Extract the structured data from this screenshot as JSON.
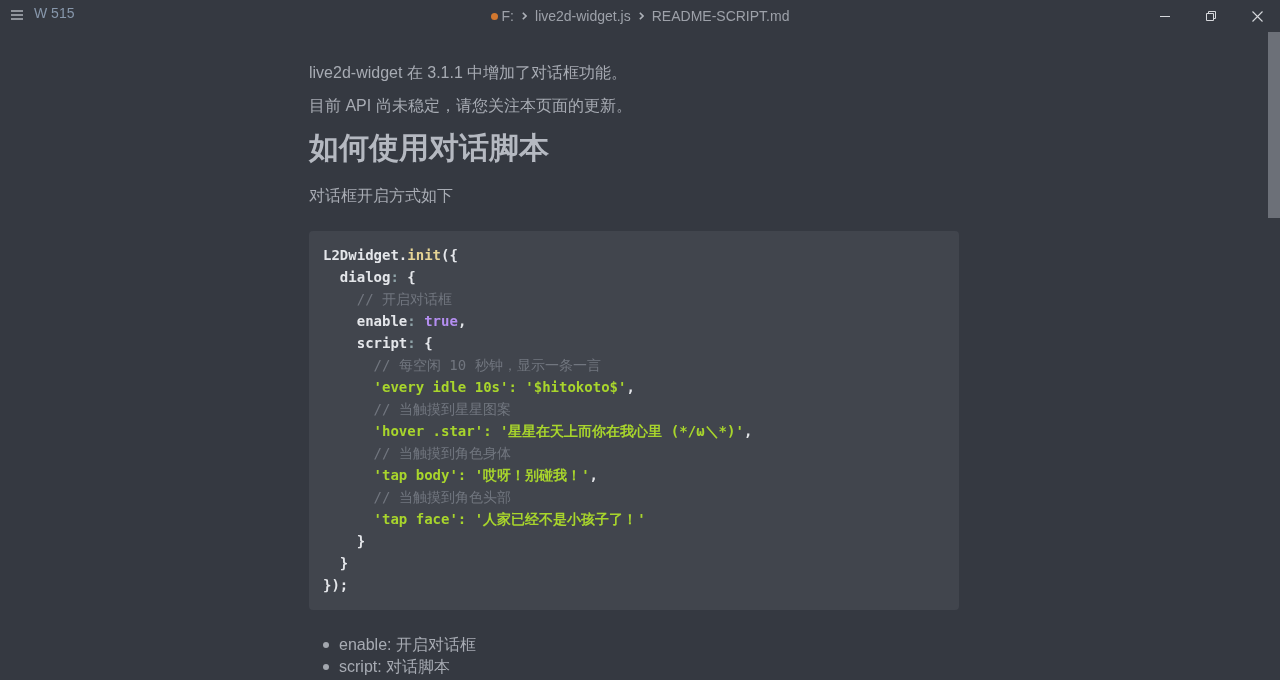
{
  "title_bar": {
    "word_count": "W 515",
    "breadcrumb": {
      "modified": true,
      "segments": [
        "F:",
        "live2d-widget.js",
        "README-SCRIPT.md"
      ]
    }
  },
  "document": {
    "blocks": [
      {
        "kind": "paragraph",
        "text": "live2d-widget 在 3.1.1 中增加了对话框功能。"
      },
      {
        "kind": "paragraph",
        "text": "目前 API 尚未稳定，请您关注本页面的更新。"
      },
      {
        "kind": "heading",
        "text": "如何使用对话脚本"
      },
      {
        "kind": "paragraph",
        "text": "对话框开启方式如下"
      },
      {
        "kind": "code",
        "lines": [
          [
            {
              "kind": "plain",
              "text": "L2Dwidget."
            },
            {
              "kind": "method",
              "text": "init"
            },
            {
              "kind": "plain",
              "text": "({"
            }
          ],
          [
            {
              "kind": "plain",
              "text": "  dialog"
            },
            {
              "kind": "punct",
              "text": ": "
            },
            {
              "kind": "plain",
              "text": "{"
            }
          ],
          [
            {
              "kind": "comment",
              "text": "    // 开启对话框"
            }
          ],
          [
            {
              "kind": "plain",
              "text": "    enable"
            },
            {
              "kind": "punct",
              "text": ": "
            },
            {
              "kind": "keyword",
              "text": "true"
            },
            {
              "kind": "plain",
              "text": ","
            }
          ],
          [
            {
              "kind": "plain",
              "text": "    script"
            },
            {
              "kind": "punct",
              "text": ": "
            },
            {
              "kind": "plain",
              "text": "{"
            }
          ],
          [
            {
              "kind": "comment",
              "text": "      // 每空闲 10 秒钟，显示一条一言"
            }
          ],
          [
            {
              "kind": "string",
              "text": "      'every idle 10s': '$hitokoto$'"
            },
            {
              "kind": "plain",
              "text": ","
            }
          ],
          [
            {
              "kind": "comment",
              "text": "      // 当触摸到星星图案"
            }
          ],
          [
            {
              "kind": "string",
              "text": "      'hover .star': '星星在天上而你在我心里 (*/ω＼*)'"
            },
            {
              "kind": "plain",
              "text": ","
            }
          ],
          [
            {
              "kind": "comment",
              "text": "      // 当触摸到角色身体"
            }
          ],
          [
            {
              "kind": "string",
              "text": "      'tap body': '哎呀！别碰我！'"
            },
            {
              "kind": "plain",
              "text": ","
            }
          ],
          [
            {
              "kind": "comment",
              "text": "      // 当触摸到角色头部"
            }
          ],
          [
            {
              "kind": "string",
              "text": "      'tap face': '人家已经不是小孩子了！'"
            }
          ],
          [
            {
              "kind": "plain",
              "text": "    }"
            }
          ],
          [
            {
              "kind": "plain",
              "text": "  }"
            }
          ],
          [
            {
              "kind": "plain",
              "text": "});"
            }
          ]
        ]
      },
      {
        "kind": "list",
        "items": [
          "enable: 开启对话框",
          "script: 对话脚本"
        ]
      }
    ]
  }
}
